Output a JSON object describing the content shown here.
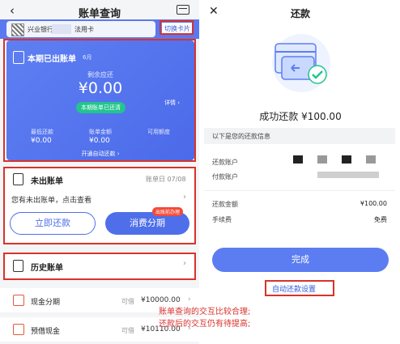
{
  "left": {
    "nav": {
      "title": "账单查询",
      "back_icon": "chevron-left-icon",
      "card_icon": "card-settings-icon"
    },
    "bank": {
      "name": "兴业银行",
      "card_type": "法用卡",
      "switch_label": "切换卡片"
    },
    "current_bill": {
      "title": "本期已出账单",
      "month": "6月",
      "due_label": "剩余应还",
      "due_amount": "¥0.00",
      "status_badge": "本期账单已还清",
      "detail_link": "详情",
      "stats": [
        {
          "label": "最低还款",
          "value": "¥0.00"
        },
        {
          "label": "账单金额",
          "value": "¥0.00"
        },
        {
          "label": "可用额度",
          "value": ""
        }
      ],
      "auto_repay_link": "开通自动还款"
    },
    "unbilled": {
      "title": "未出账单",
      "bill_date": "账单日 07/08",
      "message": "您有未出账单，点击查看",
      "repay_button": "立即还款",
      "installment_button": "消费分期",
      "installment_tag": "出账前办理"
    },
    "history": {
      "title": "历史账单"
    },
    "list": [
      {
        "label": "现金分期",
        "sub": "可借",
        "value": "¥10000.00"
      },
      {
        "label": "预借现金",
        "sub": "可借",
        "value": "¥10110.00"
      }
    ],
    "annotation": [
      "账单查询的交互比较合理;",
      "还款后的交互仍有待提高;"
    ]
  },
  "right": {
    "nav": {
      "title": "还款",
      "close_icon": "close-icon"
    },
    "success_text": "成功还款 ¥100.00",
    "section_title": "以下是您的还款信息",
    "rows": [
      {
        "label": "还款账户",
        "value": ""
      },
      {
        "label": "付款账户",
        "value": ""
      },
      {
        "label": "还款金额",
        "value": "¥100.00"
      },
      {
        "label": "手续费",
        "value": "免费"
      }
    ],
    "done_button": "完成",
    "auto_repay_link": "自动还款设置"
  },
  "colors": {
    "accent": "#4f6fea",
    "annotation_red": "#d9322b",
    "success_green": "#23c48e"
  }
}
